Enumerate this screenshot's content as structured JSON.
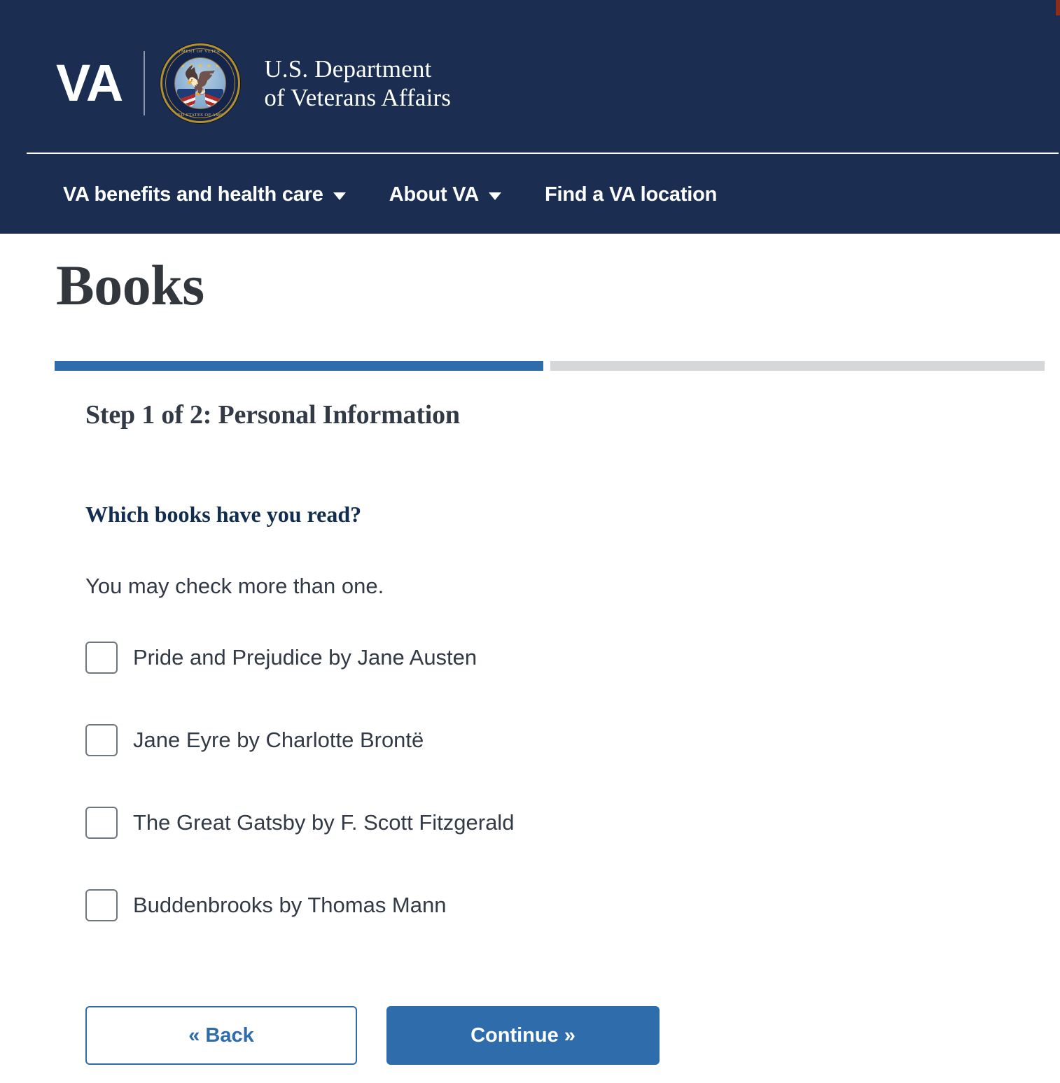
{
  "header": {
    "wordmark": "VA",
    "seal": {
      "icon": "va-seal-icon",
      "arc_top": "DEPARTMENT OF VETERANS AFFAIRS",
      "arc_bottom": "UNITED STATES OF AMERICA",
      "stars": "★ ★ ★ ★ ★",
      "eagle": "🦅"
    },
    "agency_line1": "U.S. Department",
    "agency_line2": "of Veterans Affairs",
    "background_color": "#1b2e51"
  },
  "nav": {
    "items": [
      {
        "label": "VA benefits and health care",
        "has_caret": true,
        "caret_icon": "chevron-down-icon"
      },
      {
        "label": "About VA",
        "has_caret": true,
        "caret_icon": "chevron-down-icon"
      },
      {
        "label": "Find a VA location",
        "has_caret": false
      }
    ]
  },
  "main": {
    "page_title": "Books",
    "progress": {
      "current_step": 1,
      "total_steps": 2,
      "percent_complete": 50,
      "filled_color": "#2e6cab",
      "empty_color": "#d6d7d9"
    },
    "step_heading": "Step 1 of 2: Personal Information",
    "question": {
      "legend": "Which books have you read?",
      "hint": "You may check more than one.",
      "options": [
        {
          "label": "Pride and Prejudice by Jane Austen",
          "checked": false
        },
        {
          "label": "Jane Eyre by Charlotte Brontë",
          "checked": false
        },
        {
          "label": "The Great Gatsby by F. Scott Fitzgerald",
          "checked": false
        },
        {
          "label": "Buddenbrooks by Thomas Mann",
          "checked": false
        }
      ]
    },
    "buttons": {
      "back_label": "« Back",
      "continue_label": "Continue »",
      "accent_color": "#2e6cab"
    }
  }
}
